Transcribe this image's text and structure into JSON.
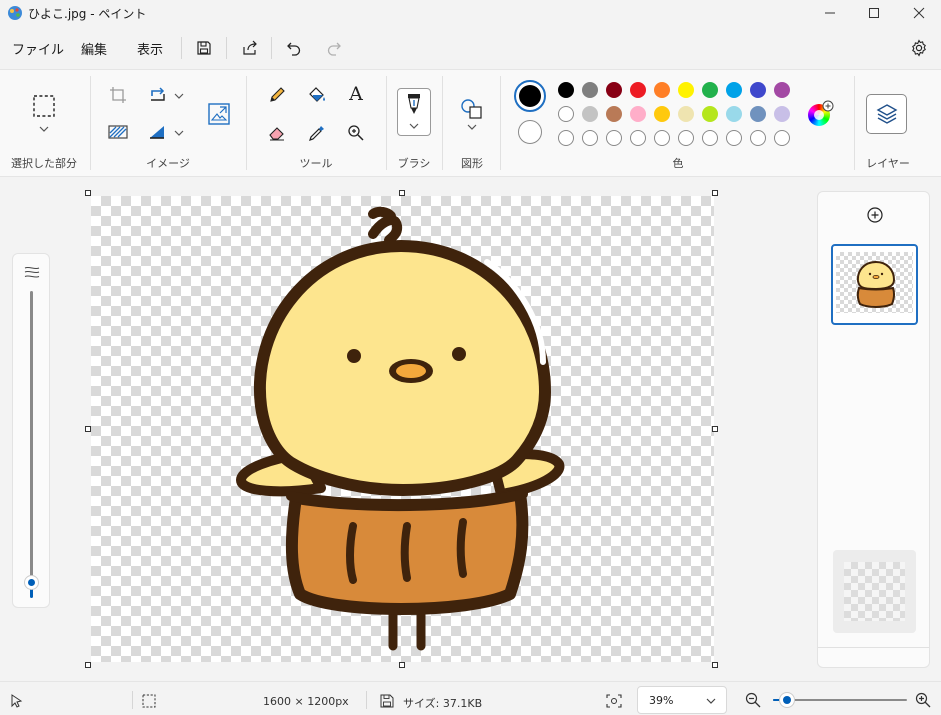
{
  "window": {
    "title": "ひよこ.jpg - ペイント"
  },
  "menu": {
    "file": "ファイル",
    "edit": "編集",
    "view": "表示"
  },
  "ribbon": {
    "groups": {
      "selection": "選択した部分",
      "image": "イメージ",
      "tools": "ツール",
      "brush": "ブラシ",
      "shapes": "図形",
      "colors": "色",
      "layers": "レイヤー"
    },
    "text_tool_glyph": "A"
  },
  "palette": {
    "primary": "#000000",
    "secondary": "#ffffff",
    "row1": [
      "#000000",
      "#7f7f7f",
      "#880015",
      "#ed1c24",
      "#ff7f27",
      "#fff200",
      "#22b14c",
      "#00a2e8",
      "#3f48cc",
      "#a349a4"
    ],
    "row2": [
      "#ffffff",
      "#c3c3c3",
      "#b97a57",
      "#ffaec9",
      "#ffc90e",
      "#efe4b0",
      "#b5e61d",
      "#99d9ea",
      "#7092be",
      "#c8bfe7"
    ],
    "row3_empty_count": 10
  },
  "canvas": {
    "subject": "chick-illustration"
  },
  "status": {
    "dimensions": "1600 × 1200px",
    "size": "サイズ: 37.1KB",
    "zoom": "39%",
    "zoom_level": 0.05
  },
  "colors": {
    "accent": "#005fb8",
    "selected_border": "#1f6fc2"
  }
}
